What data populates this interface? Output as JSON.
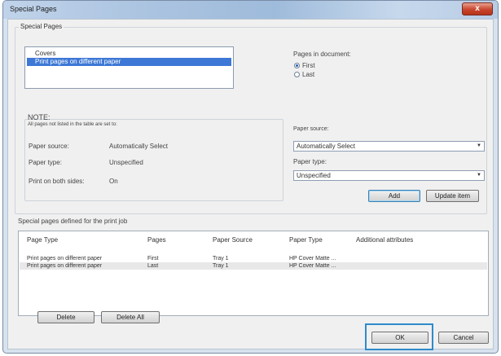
{
  "window": {
    "title": "Special Pages",
    "close_glyph": "x"
  },
  "special_pages": {
    "group_label": "Special Pages",
    "list": [
      "Covers",
      "Print pages on different paper"
    ],
    "selected_index": 1,
    "pages_in_document": {
      "label": "Pages in document:",
      "options": [
        "First",
        "Last"
      ],
      "selected": "First"
    }
  },
  "note": {
    "label": "NOTE:",
    "text": "All pages not listed in the table are set to:",
    "rows": [
      {
        "label": "Paper source:",
        "value": "Automatically Select"
      },
      {
        "label": "Paper type:",
        "value": "Unspecified"
      },
      {
        "label": "Print on both sides:",
        "value": "On"
      }
    ]
  },
  "paper": {
    "source_label": "Paper source:",
    "source_value": "Automatically Select",
    "type_label": "Paper type:",
    "type_value": "Unspecified",
    "add_label": "Add",
    "update_label": "Update item"
  },
  "defined": {
    "label": "Special pages defined for the print job",
    "columns": [
      "Page Type",
      "Pages",
      "Paper Source",
      "Paper Type",
      "Additional attributes"
    ],
    "rows": [
      [
        "Print pages on different paper",
        "First",
        "Tray 1",
        "HP Cover Matte ...",
        ""
      ],
      [
        "Print pages on different paper",
        "Last",
        "Tray 1",
        "HP Cover Matte ...",
        ""
      ]
    ],
    "delete_label": "Delete",
    "delete_all_label": "Delete All"
  },
  "footer": {
    "ok_label": "OK",
    "cancel_label": "Cancel"
  },
  "colors": {
    "selection": "#3d78d6",
    "focus": "#2f8bcb",
    "close": "#c8452d"
  }
}
